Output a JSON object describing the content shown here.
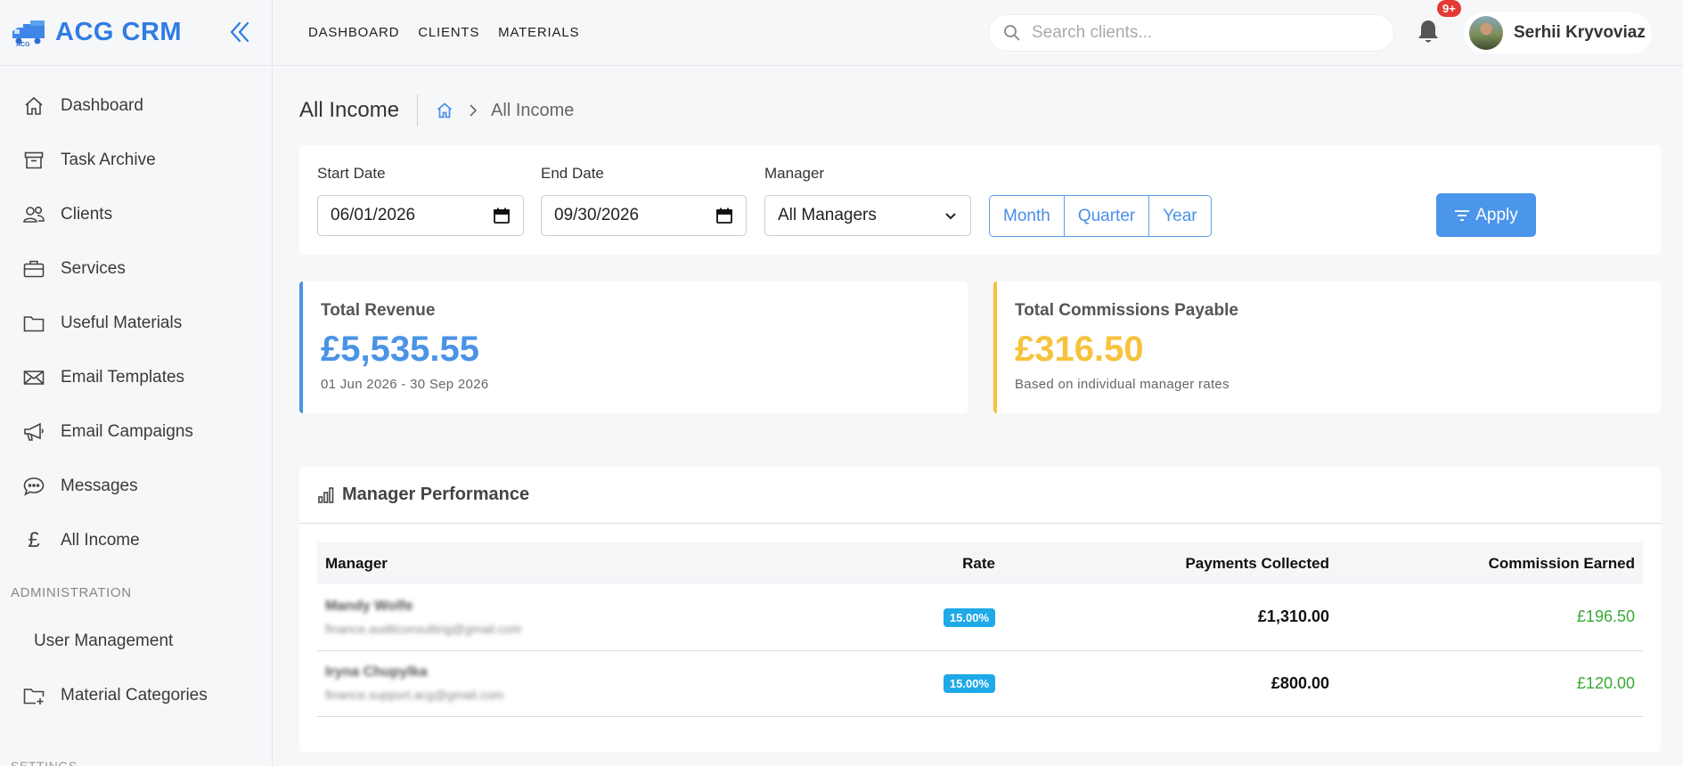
{
  "brand": {
    "name": "ACG CRM",
    "logo_icon": "truck-logo-icon"
  },
  "sidebar": {
    "items": [
      {
        "label": "Dashboard",
        "icon": "home-icon"
      },
      {
        "label": "Task Archive",
        "icon": "archive-icon"
      },
      {
        "label": "Clients",
        "icon": "users-icon"
      },
      {
        "label": "Services",
        "icon": "briefcase-icon"
      },
      {
        "label": "Useful Materials",
        "icon": "folder-icon"
      },
      {
        "label": "Email Templates",
        "icon": "envelope-icon"
      },
      {
        "label": "Email Campaigns",
        "icon": "megaphone-icon"
      },
      {
        "label": "Messages",
        "icon": "chat-icon"
      },
      {
        "label": "All Income",
        "icon": "pound-icon"
      }
    ],
    "admin_label": "ADMINISTRATION",
    "admin_items": [
      {
        "label": "User Management"
      },
      {
        "label": "Material Categories",
        "icon": "folder-plus-icon"
      }
    ],
    "bottom_label": "SETTINGS"
  },
  "topbar": {
    "nav": [
      "DASHBOARD",
      "CLIENTS",
      "MATERIALS"
    ],
    "search_placeholder": "Search clients...",
    "notification_count": "9+",
    "user_name": "Serhii Kryvoviaz"
  },
  "page": {
    "title": "All Income",
    "breadcrumb_current": "All Income"
  },
  "filters": {
    "start_label": "Start Date",
    "start_value": "06/01/2026",
    "end_label": "End Date",
    "end_value": "09/30/2026",
    "manager_label": "Manager",
    "manager_value": "All Managers",
    "periods": [
      "Month",
      "Quarter",
      "Year"
    ],
    "apply_label": "Apply"
  },
  "stats": {
    "revenue": {
      "title": "Total Revenue",
      "value": "£5,535.55",
      "sub": "01 Jun 2026 - 30 Sep 2026",
      "color": "#4a93e6"
    },
    "commissions": {
      "title": "Total Commissions Payable",
      "value": "£316.50",
      "sub": "Based on individual manager rates",
      "color": "#f7c33c"
    }
  },
  "performance": {
    "title": "Manager Performance",
    "columns": [
      "Manager",
      "Rate",
      "Payments Collected",
      "Commission Earned"
    ],
    "rows": [
      {
        "name": "Mandy Wolfe",
        "email": "finance.auditconsulting@gmail.com",
        "rate": "15.00%",
        "payments": "£1,310.00",
        "commission": "£196.50"
      },
      {
        "name": "Iryna Chupylka",
        "email": "finance.support.acg@gmail.com",
        "rate": "15.00%",
        "payments": "£800.00",
        "commission": "£120.00"
      }
    ]
  },
  "colors": {
    "accent": "#2f7de1",
    "primary_button": "#4b95ea",
    "revenue": "#4a93e6",
    "commission": "#f7c33c",
    "earned": "#3aa935",
    "badge": "#e53935"
  }
}
